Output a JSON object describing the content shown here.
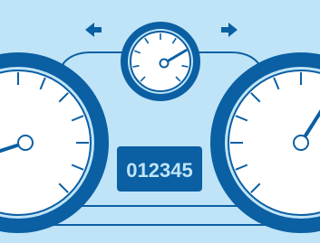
{
  "odometer": {
    "reading": "012345"
  },
  "indicators": {
    "left": {
      "icon": "arrow-left-icon"
    },
    "right": {
      "icon": "arrow-right-icon"
    }
  },
  "gauges": [
    {
      "name": "left-gauge",
      "needle_level": 0.05
    },
    {
      "name": "center-gauge",
      "needle_level": 0.72
    },
    {
      "name": "right-gauge",
      "needle_level": 0.62
    }
  ],
  "colors": {
    "background": "#bfe4f7",
    "panel": "#0b5fa3",
    "gauge_face": "#ffffff",
    "odometer_bg": "#0b5fa3",
    "odometer_text": "#bfe4f7"
  }
}
